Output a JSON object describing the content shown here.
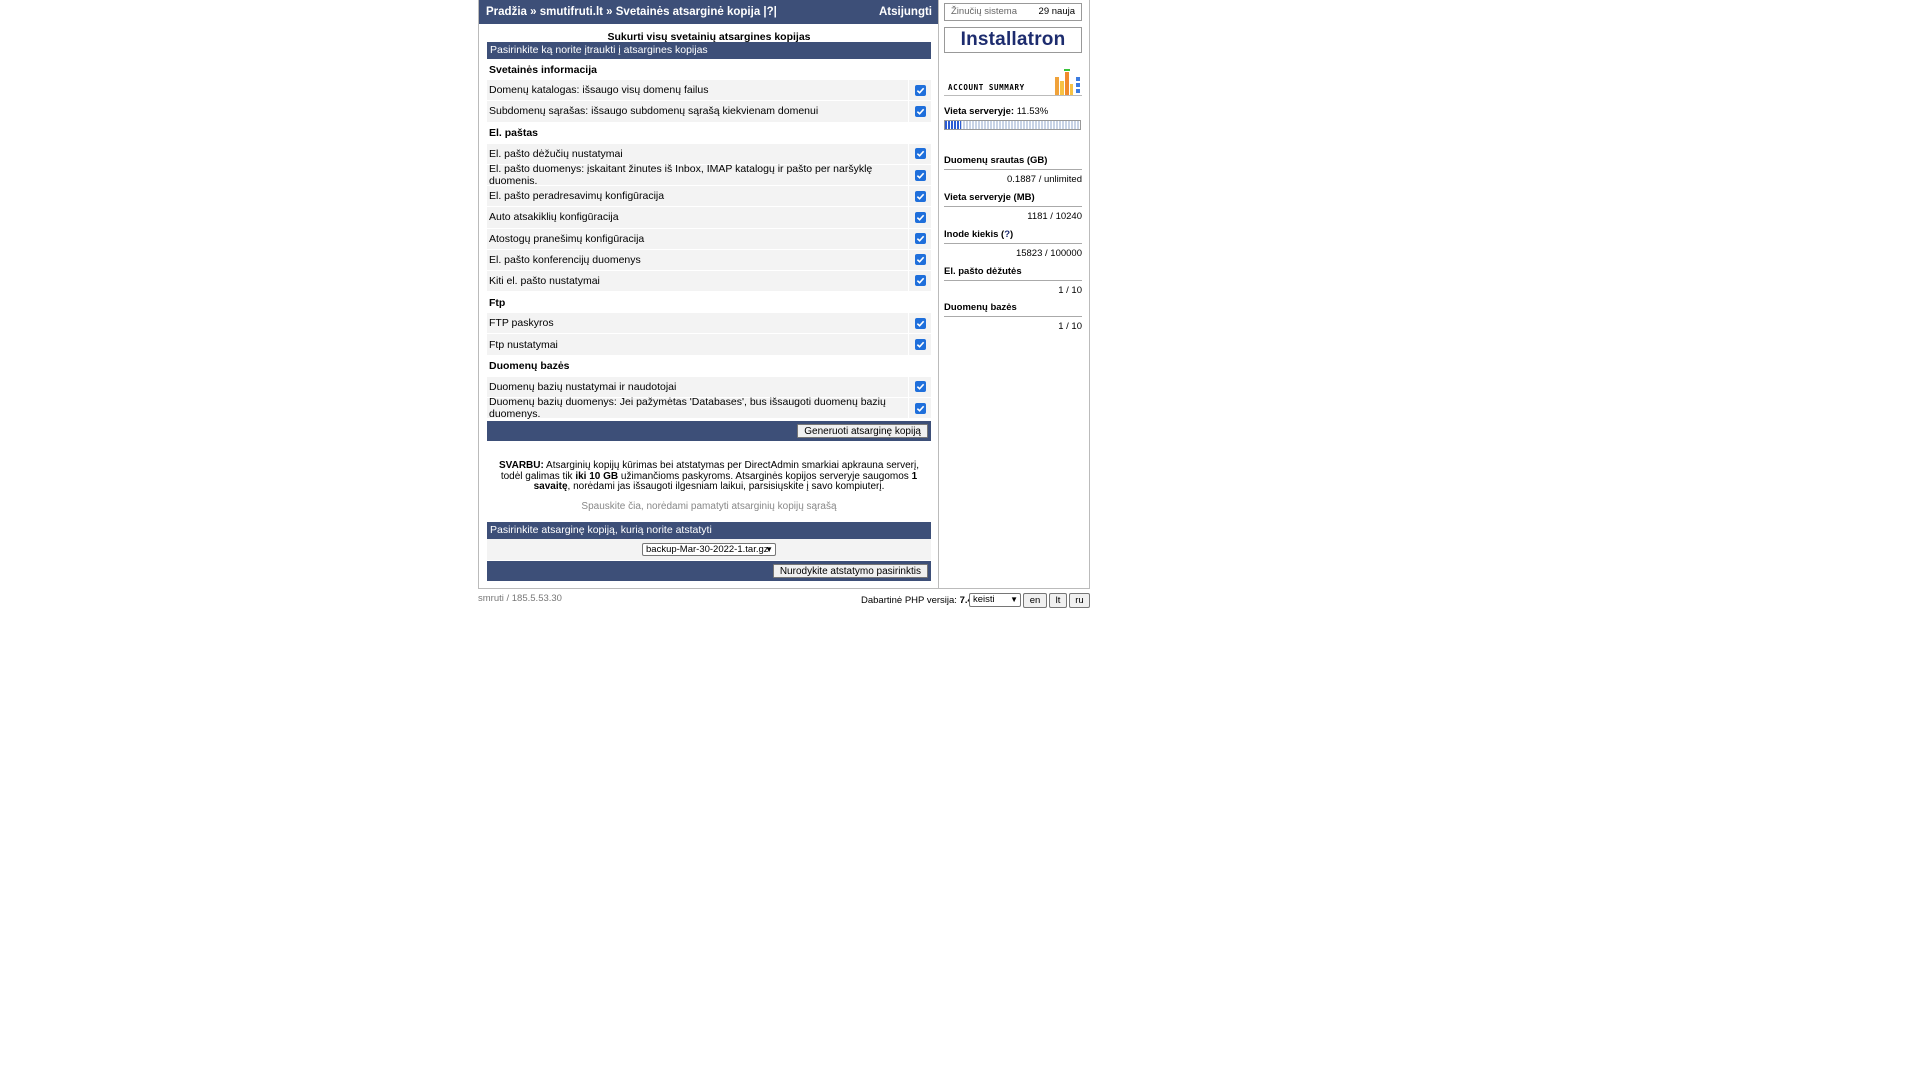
{
  "nav": {
    "crumb_home": "Pradžia",
    "sep1": " » ",
    "crumb_domain": "smutifruti.lt",
    "sep2": " » ",
    "crumb_page": "Svetainės atsarginė kopija",
    "help": " |?|",
    "logout": "Atsijungti"
  },
  "form": {
    "title": "Sukurti visų svetainių atsargines kopijas",
    "header": "Pasirinkite ką norite įtraukti į atsargines kopijas",
    "sections": [
      {
        "title": "Svetainės informacija",
        "options": [
          {
            "label": "Domenų katalogas: išsaugo visų domenų failus",
            "checked": true
          },
          {
            "label": "Subdomenų sąrašas: išsaugo subdomenų sąrašą kiekvienam domenui",
            "checked": true
          }
        ]
      },
      {
        "title": "El. paštas",
        "options": [
          {
            "label": "El. pašto dėžučių nustatymai",
            "checked": true
          },
          {
            "label": "El. pašto duomenys: įskaitant žinutes iš Inbox, IMAP katalogų ir pašto per naršyklę duomenis.",
            "checked": true
          },
          {
            "label": "El. pašto peradresavimų konfigūracija",
            "checked": true
          },
          {
            "label": "Auto atsakiklių konfigūracija",
            "checked": true
          },
          {
            "label": "Atostogų pranešimų konfigūracija",
            "checked": true
          },
          {
            "label": "El. pašto konferencijų duomenys",
            "checked": true
          },
          {
            "label": "Kiti el. pašto nustatymai",
            "checked": true
          }
        ]
      },
      {
        "title": "Ftp",
        "options": [
          {
            "label": "FTP paskyros",
            "checked": true
          },
          {
            "label": "Ftp nustatymai",
            "checked": true
          }
        ]
      },
      {
        "title": "Duomenų bazės",
        "options": [
          {
            "label": "Duomenų bazių nustatymai ir naudotojai",
            "checked": true
          },
          {
            "label": "Duomenų bazių duomenys: Jei pažymėtas 'Databases', bus išsaugoti duomenų bazių duomenys.",
            "checked": true
          }
        ]
      }
    ],
    "generate_button": "Generuoti atsarginę kopiją"
  },
  "notice": {
    "bold_prefix": "SVARBU:",
    "text1": " Atsarginių kopijų kūrimas bei atstatymas per DirectAdmin smarkiai apkrauna serverį, todėl galimas tik ",
    "bold_limit": "iki 10 GB",
    "text2": " užimančioms paskyroms. Atsarginės kopijos serveryje saugomos ",
    "bold_week": "1 savaitę",
    "text3": ", norėdami jas išsaugoti ilgesniam laikui, parsisiųskite į savo kompiuterį."
  },
  "list_link": "Spauskite čia, norėdami pamatyti atsarginių kopijų sąrašą",
  "restore": {
    "header": "Pasirinkite atsarginę kopiją, kurią norite atstatyti",
    "selected": "backup-Mar-30-2022-1.tar.gz",
    "button": "Nurodykite atstatymo pasirinktis"
  },
  "sidebar": {
    "messages_label": "Žinučių sistema",
    "messages_count": "29 nauja",
    "installatron": "Installatron",
    "account_summary": "ACCOUNT SUMMARY",
    "usage_label": "Vieta serveryje:",
    "usage_value": "11.53%",
    "usage_fraction": 0.1153,
    "stats": [
      {
        "title": "Duomenų srautas (GB)",
        "value": "0.1887 / unlimited"
      },
      {
        "title": "Vieta serveryje (MB)",
        "value": "1181 / 10240"
      },
      {
        "title": "Inode kiekis",
        "value": "15823 / 100000"
      },
      {
        "title": "El. pašto dėžutės",
        "value": "1 / 10"
      },
      {
        "title": "Duomenų bazės",
        "value": "1 / 10"
      }
    ],
    "inode_help": "?"
  },
  "footer": {
    "host": "smruti / 185.5.53.30",
    "php_label": "Dabartinė PHP versija:",
    "php_version": "7.4",
    "php_select": "keisti",
    "lang_en": "en",
    "lang_lt": "lt",
    "lang_ru": "ru"
  },
  "colors": {
    "header_bg": "#3d4f78",
    "checkbox": "#1f6fdb"
  }
}
